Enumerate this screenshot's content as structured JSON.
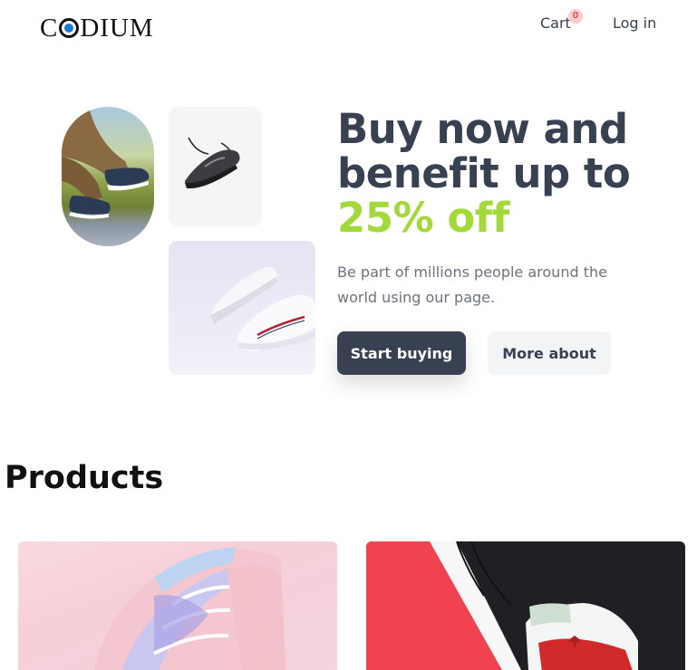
{
  "header": {
    "logo_text": "CODIUM",
    "cart_label": "Cart",
    "cart_count": "0",
    "login_label": "Log in"
  },
  "hero": {
    "headline_line1": "Buy now and",
    "headline_line2": "benefit up to",
    "headline_accent": "25% off",
    "subtitle": "Be part of millions people around the world using our page.",
    "primary_button": "Start buying",
    "secondary_button": "More about",
    "colors": {
      "headline": "#374151",
      "accent": "#a3d93a",
      "primary_bg": "#374151",
      "secondary_bg": "#f3f4f6"
    }
  },
  "products": {
    "title": "Products"
  }
}
